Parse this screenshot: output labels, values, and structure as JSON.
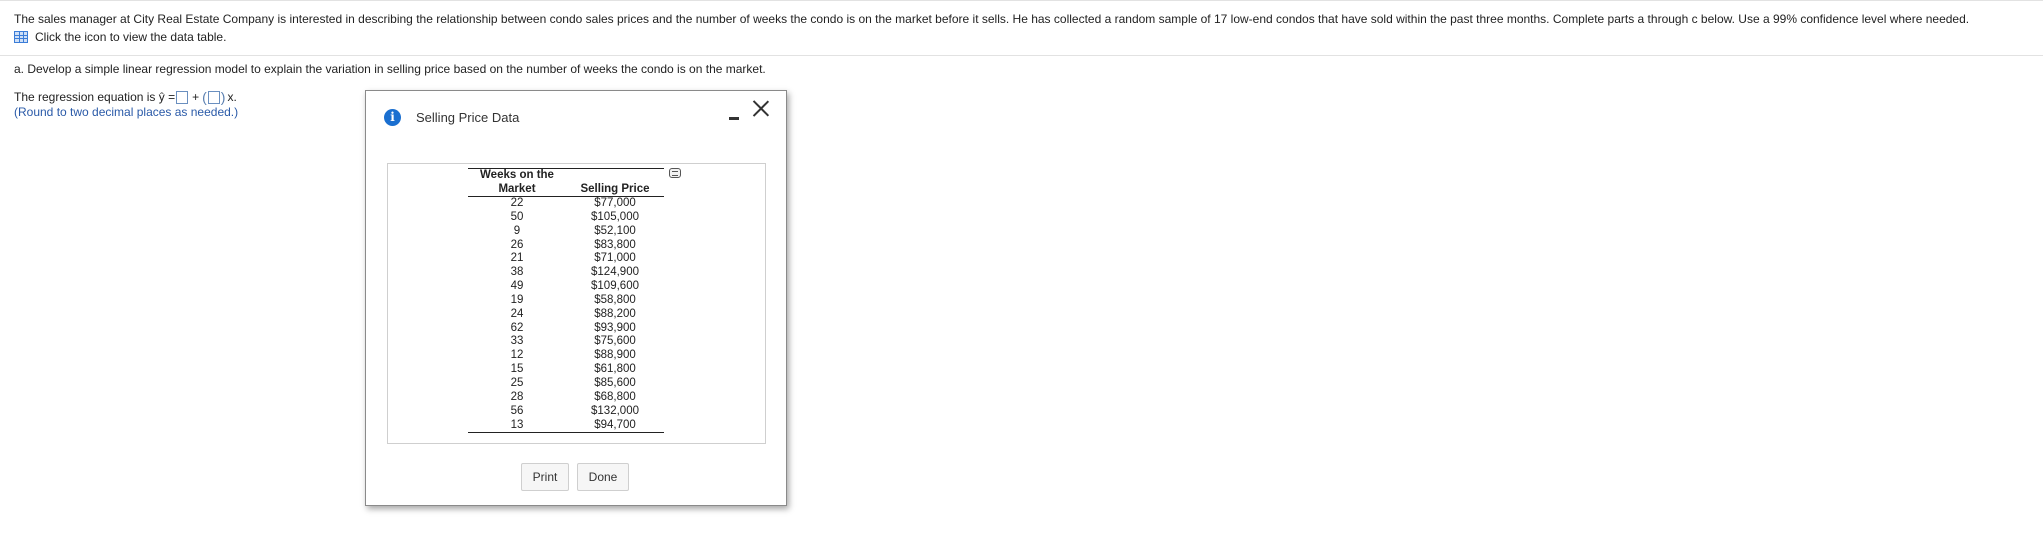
{
  "intro_text": "The sales manager at City Real Estate Company is interested in describing the relationship between condo sales prices and the number of weeks the condo is on the market before it sells. He has collected a random sample of 17 low-end condos that have sold within the past three months. Complete parts a through c below. Use a 99% confidence level where needed.",
  "data_link": {
    "label": "Click the icon to view the data table.",
    "icon": "data-table-icon"
  },
  "part_a": "a. Develop a simple linear regression model to explain the variation in selling price based on the number of weeks the condo is on the market.",
  "equation": {
    "prefix": "The regression equation is ŷ =",
    "plus": "+",
    "suffix": "x.",
    "intercept_value": "",
    "slope_value": ""
  },
  "round_note": "(Round to two decimal places as needed.)",
  "dialog": {
    "title": "Selling Price Data",
    "info_icon": "info-icon",
    "minimize_icon": "minimize-icon",
    "close_icon": "close-icon",
    "table": {
      "col1_header_line1": "Weeks on the",
      "col1_header_line2": "Market",
      "col2_header": "Selling Price",
      "rows": [
        [
          "22",
          "$77,000"
        ],
        [
          "50",
          "$105,000"
        ],
        [
          "9",
          "$52,100"
        ],
        [
          "26",
          "$83,800"
        ],
        [
          "21",
          "$71,000"
        ],
        [
          "38",
          "$124,900"
        ],
        [
          "49",
          "$109,600"
        ],
        [
          "19",
          "$58,800"
        ],
        [
          "24",
          "$88,200"
        ],
        [
          "62",
          "$93,900"
        ],
        [
          "33",
          "$75,600"
        ],
        [
          "12",
          "$88,900"
        ],
        [
          "15",
          "$61,800"
        ],
        [
          "25",
          "$85,600"
        ],
        [
          "28",
          "$68,800"
        ],
        [
          "56",
          "$132,000"
        ],
        [
          "13",
          "$94,700"
        ]
      ]
    },
    "buttons": {
      "print": "Print",
      "done": "Done"
    }
  }
}
